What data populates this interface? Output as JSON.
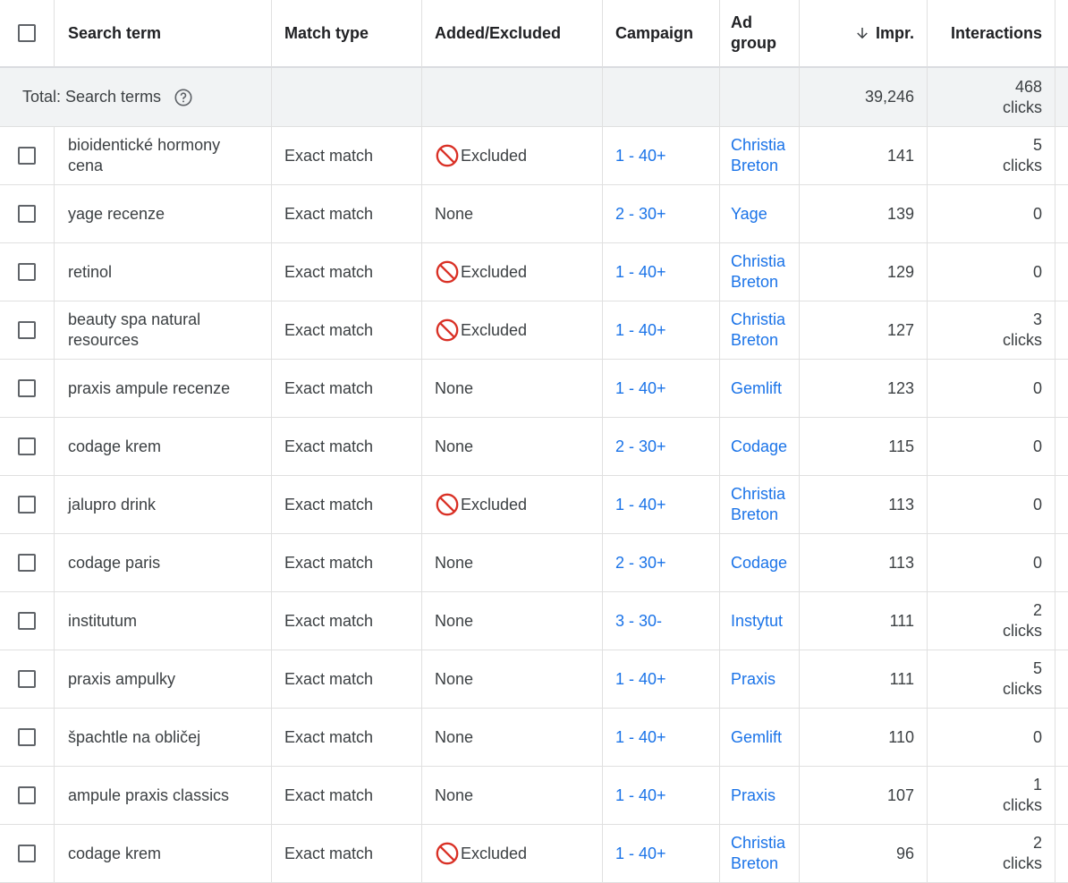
{
  "headers": {
    "search_term": "Search term",
    "match_type": "Match type",
    "added_excluded": "Added/Excluded",
    "campaign": "Campaign",
    "ad_group_line1": "Ad",
    "ad_group_line2": "group",
    "impr": "Impr.",
    "interactions": "Interactions"
  },
  "total": {
    "label": "Total: Search terms",
    "impr": "39,246",
    "interactions_count": "468",
    "interactions_unit": "clicks"
  },
  "rows": [
    {
      "term": "bioidentické hormony cena",
      "match": "Exact match",
      "status": "Excluded",
      "excluded": true,
      "campaign": "1 - 40+",
      "adgroup1": "Christia",
      "adgroup2": "Breton",
      "impr": "141",
      "inter1": "5",
      "inter2": "clicks"
    },
    {
      "term": "yage recenze",
      "match": "Exact match",
      "status": "None",
      "excluded": false,
      "campaign": "2 - 30+",
      "adgroup1": "Yage",
      "adgroup2": "",
      "impr": "139",
      "inter1": "0",
      "inter2": ""
    },
    {
      "term": "retinol",
      "match": "Exact match",
      "status": "Excluded",
      "excluded": true,
      "campaign": "1 - 40+",
      "adgroup1": "Christia",
      "adgroup2": "Breton",
      "impr": "129",
      "inter1": "0",
      "inter2": ""
    },
    {
      "term": "beauty spa natural resources",
      "match": "Exact match",
      "status": "Excluded",
      "excluded": true,
      "campaign": "1 - 40+",
      "adgroup1": "Christia",
      "adgroup2": "Breton",
      "impr": "127",
      "inter1": "3",
      "inter2": "clicks"
    },
    {
      "term": "praxis ampule recenze",
      "match": "Exact match",
      "status": "None",
      "excluded": false,
      "campaign": "1 - 40+",
      "adgroup1": "Gemlift",
      "adgroup2": "",
      "impr": "123",
      "inter1": "0",
      "inter2": ""
    },
    {
      "term": "codage krem",
      "match": "Exact match",
      "status": "None",
      "excluded": false,
      "campaign": "2 - 30+",
      "adgroup1": "Codage",
      "adgroup2": "",
      "impr": "115",
      "inter1": "0",
      "inter2": ""
    },
    {
      "term": "jalupro drink",
      "match": "Exact match",
      "status": "Excluded",
      "excluded": true,
      "campaign": "1 - 40+",
      "adgroup1": "Christia",
      "adgroup2": "Breton",
      "impr": "113",
      "inter1": "0",
      "inter2": ""
    },
    {
      "term": "codage paris",
      "match": "Exact match",
      "status": "None",
      "excluded": false,
      "campaign": "2 - 30+",
      "adgroup1": "Codage",
      "adgroup2": "",
      "impr": "113",
      "inter1": "0",
      "inter2": ""
    },
    {
      "term": "institutum",
      "match": "Exact match",
      "status": "None",
      "excluded": false,
      "campaign": "3 - 30-",
      "adgroup1": "Instytut",
      "adgroup2": "",
      "impr": "111",
      "inter1": "2",
      "inter2": "clicks"
    },
    {
      "term": "praxis ampulky",
      "match": "Exact match",
      "status": "None",
      "excluded": false,
      "campaign": "1 - 40+",
      "adgroup1": "Praxis",
      "adgroup2": "",
      "impr": "111",
      "inter1": "5",
      "inter2": "clicks"
    },
    {
      "term": "špachtle na obličej",
      "match": "Exact match",
      "status": "None",
      "excluded": false,
      "campaign": "1 - 40+",
      "adgroup1": "Gemlift",
      "adgroup2": "",
      "impr": "110",
      "inter1": "0",
      "inter2": ""
    },
    {
      "term": "ampule praxis classics",
      "match": "Exact match",
      "status": "None",
      "excluded": false,
      "campaign": "1 - 40+",
      "adgroup1": "Praxis",
      "adgroup2": "",
      "impr": "107",
      "inter1": "1",
      "inter2": "clicks"
    },
    {
      "term": "codage krem",
      "match": "Exact match",
      "status": "Excluded",
      "excluded": true,
      "campaign": "1 - 40+",
      "adgroup1": "Christia",
      "adgroup2": "Breton",
      "impr": "96",
      "inter1": "2",
      "inter2": "clicks"
    }
  ],
  "icons": {
    "excluded": "block-icon",
    "sort": "arrow-down-icon",
    "help": "help-circle-icon"
  },
  "colors": {
    "link": "#1a73e8",
    "excluded_icon": "#d93025",
    "total_bg": "#f1f3f4"
  }
}
